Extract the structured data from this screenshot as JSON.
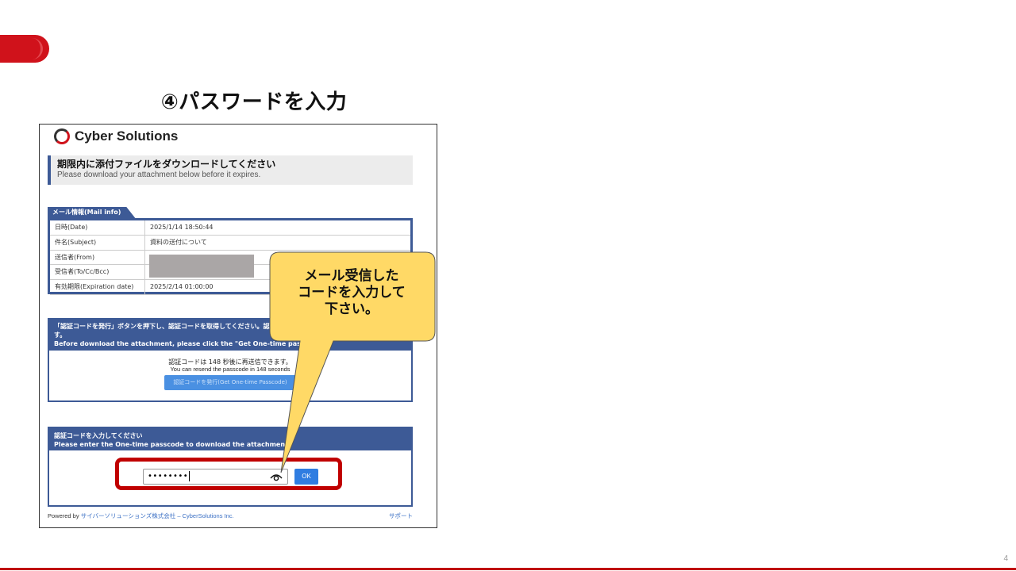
{
  "slide": {
    "title": "④パスワードを入力",
    "page_number": "4"
  },
  "app": {
    "logo_text": "Cyber Solutions"
  },
  "notice": {
    "title_jp": "期限内に添付ファイルをダウンロードしてください",
    "title_en": "Please download your attachment below before it expires."
  },
  "mail_info": {
    "tab_label": "メール情報(Mail info)",
    "rows": [
      {
        "key": "日時(Date)",
        "value": "2025/1/14 18:50:44"
      },
      {
        "key": "件名(Subject)",
        "value": "資料の送付について"
      },
      {
        "key": "送信者(From)",
        "value": ""
      },
      {
        "key": "受信者(To/Cc/Bcc)",
        "value": ""
      },
      {
        "key": "有効期限(Expiration date)",
        "value": "2025/2/14 01:00:00"
      }
    ]
  },
  "code_request": {
    "header_line1": "「認証コードを発行」ボタンを押下し、認証コードを取得してください。認",
    "header_line2": "す。",
    "header_line3": "Before download the attachment, please click the \"Get One-time pass",
    "resend_jp": "認証コードは 148 秒後に再送信できます。",
    "resend_en": "You can resend the passcode in 148 seconds",
    "button_label": "認証コードを発行(Get One-time Passcode)"
  },
  "code_entry": {
    "header_jp": "認証コードを入力してください",
    "header_en": "Please enter the One-time passcode to download the attachment.",
    "password_value": "••••••••",
    "ok_label": "OK"
  },
  "footer": {
    "powered_by": "Powered by ",
    "company": "サイバーソリューションズ株式会社 – CyberSolutions Inc.",
    "support": "サポート"
  },
  "callout": {
    "line1": "メール受信した",
    "line2": "コードを入力して",
    "line3": "下さい。",
    "fill_color": "#ffd966"
  },
  "colors": {
    "brand_red": "#d0121b",
    "header_blue": "#3d5a96",
    "button_blue": "#2f7de1",
    "highlight_red": "#c00000"
  }
}
